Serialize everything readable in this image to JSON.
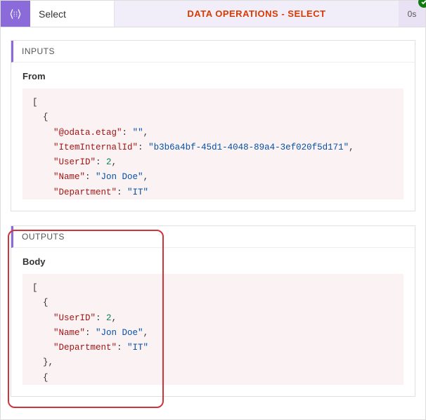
{
  "header": {
    "action_name": "Select",
    "operation_title": "DATA OPERATIONS - SELECT",
    "duration": "0s"
  },
  "panels": {
    "inputs": {
      "title": "INPUTS",
      "field_label": "From",
      "json_lines": [
        {
          "indent": 0,
          "tokens": [
            {
              "t": "p",
              "v": "["
            }
          ]
        },
        {
          "indent": 1,
          "tokens": [
            {
              "t": "p",
              "v": "{"
            }
          ]
        },
        {
          "indent": 2,
          "tokens": [
            {
              "t": "k",
              "v": "\"@odata.etag\""
            },
            {
              "t": "p",
              "v": ": "
            },
            {
              "t": "s",
              "v": "\"\""
            },
            {
              "t": "p",
              "v": ","
            }
          ]
        },
        {
          "indent": 2,
          "tokens": [
            {
              "t": "k",
              "v": "\"ItemInternalId\""
            },
            {
              "t": "p",
              "v": ": "
            },
            {
              "t": "s",
              "v": "\"b3b6a4bf-45d1-4048-89a4-3ef020f5d171\""
            },
            {
              "t": "p",
              "v": ","
            }
          ]
        },
        {
          "indent": 2,
          "tokens": [
            {
              "t": "k",
              "v": "\"UserID\""
            },
            {
              "t": "p",
              "v": ": "
            },
            {
              "t": "n",
              "v": "2"
            },
            {
              "t": "p",
              "v": ","
            }
          ]
        },
        {
          "indent": 2,
          "tokens": [
            {
              "t": "k",
              "v": "\"Name\""
            },
            {
              "t": "p",
              "v": ": "
            },
            {
              "t": "s",
              "v": "\"Jon Doe\""
            },
            {
              "t": "p",
              "v": ","
            }
          ]
        },
        {
          "indent": 2,
          "tokens": [
            {
              "t": "k",
              "v": "\"Department\""
            },
            {
              "t": "p",
              "v": ": "
            },
            {
              "t": "s",
              "v": "\"IT\""
            }
          ]
        }
      ]
    },
    "outputs": {
      "title": "OUTPUTS",
      "field_label": "Body",
      "json_lines": [
        {
          "indent": 0,
          "tokens": [
            {
              "t": "p",
              "v": "["
            }
          ]
        },
        {
          "indent": 1,
          "tokens": [
            {
              "t": "p",
              "v": "{"
            }
          ]
        },
        {
          "indent": 2,
          "tokens": [
            {
              "t": "k",
              "v": "\"UserID\""
            },
            {
              "t": "p",
              "v": ": "
            },
            {
              "t": "n",
              "v": "2"
            },
            {
              "t": "p",
              "v": ","
            }
          ]
        },
        {
          "indent": 2,
          "tokens": [
            {
              "t": "k",
              "v": "\"Name\""
            },
            {
              "t": "p",
              "v": ": "
            },
            {
              "t": "s",
              "v": "\"Jon Doe\""
            },
            {
              "t": "p",
              "v": ","
            }
          ]
        },
        {
          "indent": 2,
          "tokens": [
            {
              "t": "k",
              "v": "\"Department\""
            },
            {
              "t": "p",
              "v": ": "
            },
            {
              "t": "s",
              "v": "\"IT\""
            }
          ]
        },
        {
          "indent": 1,
          "tokens": [
            {
              "t": "p",
              "v": "},"
            }
          ]
        },
        {
          "indent": 1,
          "tokens": [
            {
              "t": "p",
              "v": "{"
            }
          ]
        }
      ]
    }
  }
}
